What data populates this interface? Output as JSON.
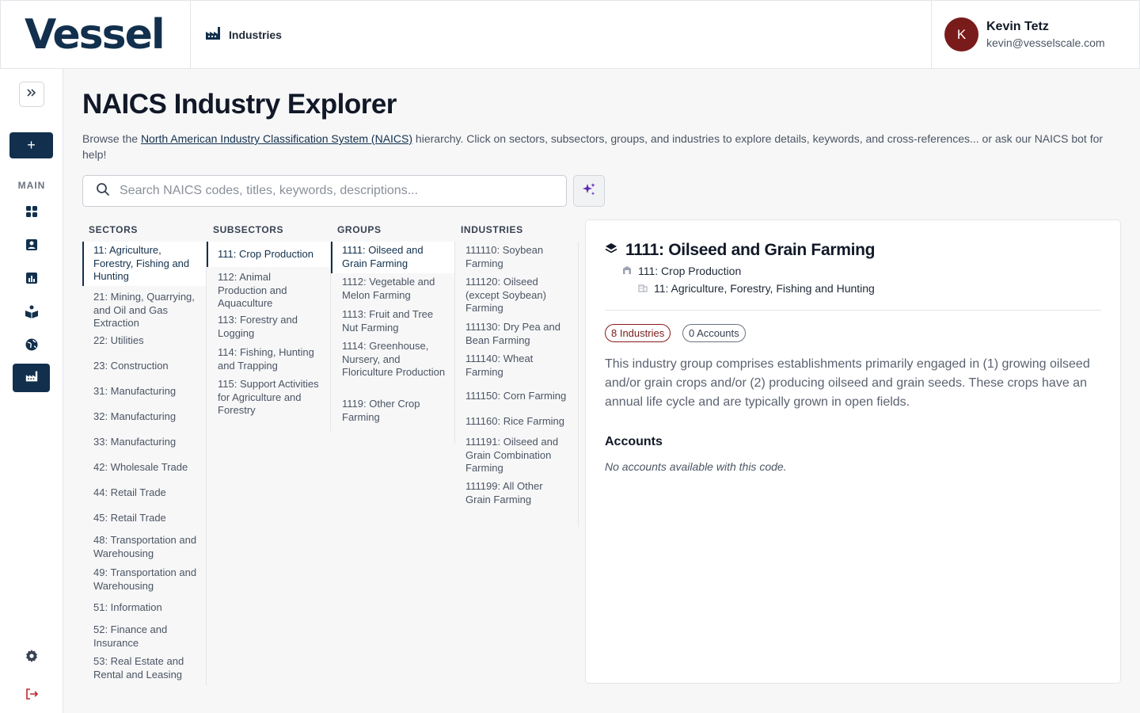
{
  "header": {
    "logo_text": "Vessel",
    "breadcrumb_label": "Industries",
    "user": {
      "initial": "K",
      "name": "Kevin Tetz",
      "email": "kevin@vesselscale.com"
    }
  },
  "sidebar": {
    "section_label": "MAIN",
    "collapse_icon": "double-chevron-right-icon",
    "add_label": "+",
    "nav": [
      "dashboard-icon",
      "contacts-icon",
      "reports-icon",
      "learn-icon",
      "globe-icon",
      "industries-icon"
    ],
    "active_nav": "industries-icon",
    "bottom": [
      "settings-icon",
      "logout-icon"
    ]
  },
  "main": {
    "title": "NAICS Industry Explorer",
    "desc_before": "Browse the ",
    "desc_link": "North American Industry Classification System (NAICS)",
    "desc_after": " hierarchy. Click on sectors, subsectors, groups, and industries to explore details, keywords, and cross-references... or ask our NAICS bot for help!",
    "search_placeholder": "Search NAICS codes, titles, keywords, descriptions..."
  },
  "columns": {
    "sectors": {
      "header": "SECTORS",
      "items": [
        "11: Agriculture, Forestry, Fishing and Hunting",
        "21: Mining, Quarrying, and Oil and Gas Extraction",
        "22: Utilities",
        "23: Construction",
        "31: Manufacturing",
        "32: Manufacturing",
        "33: Manufacturing",
        "42: Wholesale Trade",
        "44: Retail Trade",
        "45: Retail Trade",
        "48: Transportation and Warehousing",
        "49: Transportation and Warehousing",
        "51: Information",
        "52: Finance and Insurance",
        "53: Real Estate and Rental and Leasing"
      ]
    },
    "subsectors": {
      "header": "SUBSECTORS",
      "items": [
        "111: Crop Production",
        "112: Animal Production and Aquaculture",
        "113: Forestry and Logging",
        "114: Fishing, Hunting and Trapping",
        "115: Support Activities for Agriculture and Forestry"
      ]
    },
    "groups": {
      "header": "GROUPS",
      "items": [
        "1111: Oilseed and Grain Farming",
        "1112: Vegetable and Melon Farming",
        "1113: Fruit and Tree Nut Farming",
        "1114: Greenhouse, Nursery, and Floriculture Production",
        "1119: Other Crop Farming"
      ]
    },
    "industries": {
      "header": "INDUSTRIES",
      "items": [
        "111110: Soybean Farming",
        "111120: Oilseed (except Soybean) Farming",
        "111130: Dry Pea and Bean Farming",
        "111140: Wheat Farming",
        "111150: Corn Farming",
        "111160: Rice Farming",
        "111191: Oilseed and Grain Combination Farming",
        "111199: All Other Grain Farming"
      ]
    }
  },
  "detail": {
    "title": "1111: Oilseed and Grain Farming",
    "parent": "111: Crop Production",
    "grandparent": "11: Agriculture, Forestry, Fishing and Hunting",
    "industries_badge": "8 Industries",
    "accounts_badge": "0 Accounts",
    "description": "This industry group comprises establishments primarily engaged in (1) growing oilseed and/or grain crops and/or (2) producing oilseed and grain seeds. These crops have an annual life cycle and are typically grown in open fields.",
    "accounts_heading": "Accounts",
    "accounts_empty": "No accounts available with this code."
  },
  "colors": {
    "brand": "#12304d",
    "badge_red": "#7a1b1b"
  }
}
